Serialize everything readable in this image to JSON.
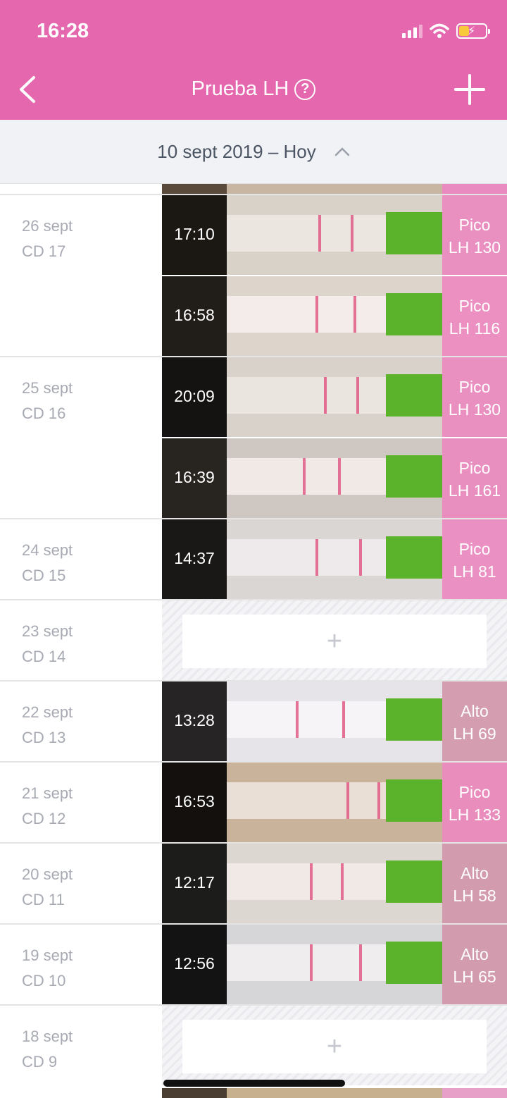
{
  "status_bar": {
    "time": "16:28"
  },
  "nav": {
    "title": "Prueba LH",
    "help_symbol": "?",
    "back_icon": "chevron-left-icon",
    "add_icon": "plus-icon"
  },
  "date_header": {
    "text": "10 sept 2019 – Hoy",
    "toggle_icon": "chevron-up-icon"
  },
  "colors": {
    "accent": "#e567ad",
    "result_tag": "#ec8ac0",
    "header_bg": "#f1f2f5",
    "label_text": "#a7aab3",
    "strip_control": "#5ab32a"
  },
  "days": [
    {
      "date": "26 sept",
      "cd": "CD 17",
      "entries": [
        {
          "time": "17:10",
          "level": "Pico",
          "lh": "LH 130"
        },
        {
          "time": "16:58",
          "level": "Pico",
          "lh": "LH 116"
        }
      ]
    },
    {
      "date": "25 sept",
      "cd": "CD 16",
      "entries": [
        {
          "time": "20:09",
          "level": "Pico",
          "lh": "LH 130"
        },
        {
          "time": "16:39",
          "level": "Pico",
          "lh": "LH 161"
        }
      ]
    },
    {
      "date": "24 sept",
      "cd": "CD 15",
      "entries": [
        {
          "time": "14:37",
          "level": "Pico",
          "lh": "LH 81"
        }
      ]
    },
    {
      "date": "23 sept",
      "cd": "CD 14",
      "entries": [],
      "add_symbol": "+"
    },
    {
      "date": "22 sept",
      "cd": "CD 13",
      "entries": [
        {
          "time": "13:28",
          "level": "Alto",
          "lh": "LH 69"
        }
      ]
    },
    {
      "date": "21 sept",
      "cd": "CD 12",
      "entries": [
        {
          "time": "16:53",
          "level": "Pico",
          "lh": "LH 133"
        }
      ]
    },
    {
      "date": "20 sept",
      "cd": "CD 11",
      "entries": [
        {
          "time": "12:17",
          "level": "Alto",
          "lh": "LH 58"
        }
      ]
    },
    {
      "date": "19 sept",
      "cd": "CD 10",
      "entries": [
        {
          "time": "12:56",
          "level": "Alto",
          "lh": "LH 65"
        }
      ]
    },
    {
      "date": "18 sept",
      "cd": "CD 9",
      "entries": [],
      "add_symbol": "+"
    }
  ]
}
